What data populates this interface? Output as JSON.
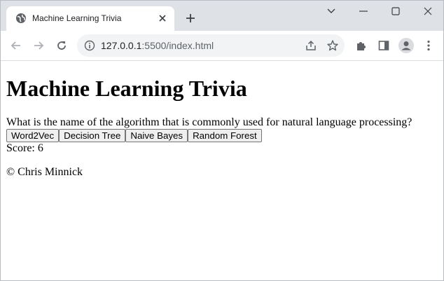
{
  "browser": {
    "tab_title": "Machine Learning Trivia",
    "url_host": "127.0.0.1",
    "url_path": ":5500/index.html"
  },
  "page": {
    "heading": "Machine Learning Trivia",
    "question": "What is the name of the algorithm that is commonly used for natural language processing?",
    "answers": [
      "Word2Vec",
      "Decision Tree",
      "Naive Bayes",
      "Random Forest"
    ],
    "score_label": "Score: 6",
    "footer": "© Chris Minnick"
  },
  "colors": {
    "tabstrip_bg": "#dee1e6",
    "omnibox_bg": "#f1f3f4",
    "button_bg": "#efefef"
  }
}
